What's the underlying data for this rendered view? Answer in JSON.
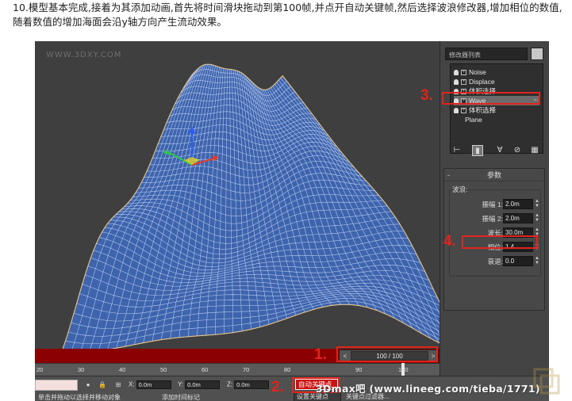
{
  "intro_text": "10.模型基本完成,接着为其添加动画,首先将时间滑块拖动到第100帧,并点开自动关键帧,然后选择波浪修改器,增加相位的数值,随着数值的增加海面会沿y轴方向产生流动效果。",
  "viewport": {
    "watermark": "WWW.3DXY.COM",
    "mesh_color": "#3e64ad",
    "wire_color": "#cfe0ff"
  },
  "command_panel": {
    "modifier_list_label": "修改器列表",
    "stack": [
      {
        "label": "Noise",
        "selected": false
      },
      {
        "label": "Displace",
        "selected": false
      },
      {
        "label": "体积选择",
        "selected": false
      },
      {
        "label": "Wave",
        "selected": true
      },
      {
        "label": "体积选择",
        "selected": false
      },
      {
        "label": "Plane",
        "selected": false
      }
    ],
    "params_title": "参数",
    "group_label": "波浪:",
    "params": [
      {
        "label": "振幅 1:",
        "value": "2.0m"
      },
      {
        "label": "振幅 2:",
        "value": "2.0m"
      },
      {
        "label": "波长:",
        "value": "30.0m"
      },
      {
        "label": "相位:",
        "value": "1.4"
      },
      {
        "label": "衰退:",
        "value": "0.0"
      }
    ]
  },
  "annotations": {
    "step1": "1.",
    "step2": "2.",
    "step3": "3.",
    "step4": "4.",
    "color": "#e0241b"
  },
  "timeline": {
    "frame_display": "100 / 100",
    "prev_label": "<",
    "next_label": ">",
    "ticks": [
      "20",
      "30",
      "40",
      "50",
      "60",
      "70",
      "80",
      "90",
      "100"
    ]
  },
  "statusbar": {
    "x_label": "X:",
    "x_value": "0.0m",
    "y_label": "Y:",
    "y_value": "0.0m",
    "z_label": "Z:",
    "z_value": "0.0m",
    "hint1": "单击并拖动以选择并移动对象",
    "hint2": "添加时间标记",
    "auto_key": "自动关键点",
    "set_key": "设置关键点",
    "key_filter": "关键点过滤器..."
  },
  "site_watermark": "3Dmax吧 (www.lineeg.com/tieba/1771)"
}
